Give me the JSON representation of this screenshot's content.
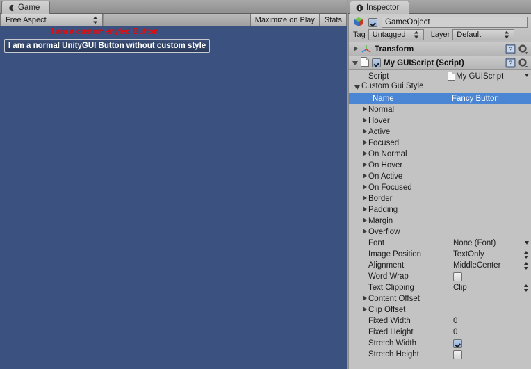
{
  "game_panel": {
    "tab_label": "Game",
    "tab_icon": "game-controller-icon",
    "toolbar": {
      "aspect_value": "Free Aspect",
      "maximize_label": "Maximize on Play",
      "stats_label": "Stats"
    },
    "view": {
      "background_color": "#3b5280",
      "custom_label_text": "I am a custom-styled Button",
      "custom_label_color": "#e00b0b",
      "button_label": "I am a normal UnityGUI Button without custom style"
    }
  },
  "inspector": {
    "tab_label": "Inspector",
    "tab_icon": "info-circle-icon",
    "object": {
      "enabled": true,
      "name": "GameObject",
      "tag_label": "Tag",
      "tag_value": "Untagged",
      "layer_label": "Layer",
      "layer_value": "Default"
    },
    "components": [
      {
        "title": "Transform",
        "expanded": false,
        "icon": "transform-axis-icon",
        "has_checkbox": false
      },
      {
        "title": "My GUIScript (Script)",
        "expanded": true,
        "icon": "script-page-icon",
        "has_checkbox": true,
        "enabled": true
      }
    ],
    "script_row": {
      "label": "Script",
      "value": "My GUIScript"
    },
    "custom_gui_style": {
      "group_label": "Custom Gui Style",
      "expanded": true,
      "name_row": {
        "label": "Name",
        "value": "Fancy Button",
        "selected": true,
        "highlight_color": "#4a86d4"
      },
      "state_foldouts": [
        "Normal",
        "Hover",
        "Active",
        "Focused",
        "On Normal",
        "On Hover",
        "On Active",
        "On Focused",
        "Border",
        "Padding",
        "Margin",
        "Overflow"
      ],
      "properties": [
        {
          "label": "Font",
          "value": "None (Font)",
          "control": "object-popup"
        },
        {
          "label": "Image Position",
          "value": "TextOnly",
          "control": "enum-popup"
        },
        {
          "label": "Alignment",
          "value": "MiddleCenter",
          "control": "enum-popup"
        },
        {
          "label": "Word Wrap",
          "value": "",
          "control": "checkbox",
          "checked": false
        },
        {
          "label": "Text Clipping",
          "value": "Clip",
          "control": "enum-popup"
        }
      ],
      "offset_foldouts": [
        "Content Offset",
        "Clip Offset"
      ],
      "size_properties": [
        {
          "label": "Fixed Width",
          "value": "0",
          "control": "number"
        },
        {
          "label": "Fixed Height",
          "value": "0",
          "control": "number"
        },
        {
          "label": "Stretch Width",
          "value": "",
          "control": "checkbox",
          "checked": true
        },
        {
          "label": "Stretch Height",
          "value": "",
          "control": "checkbox",
          "checked": false
        }
      ]
    }
  }
}
